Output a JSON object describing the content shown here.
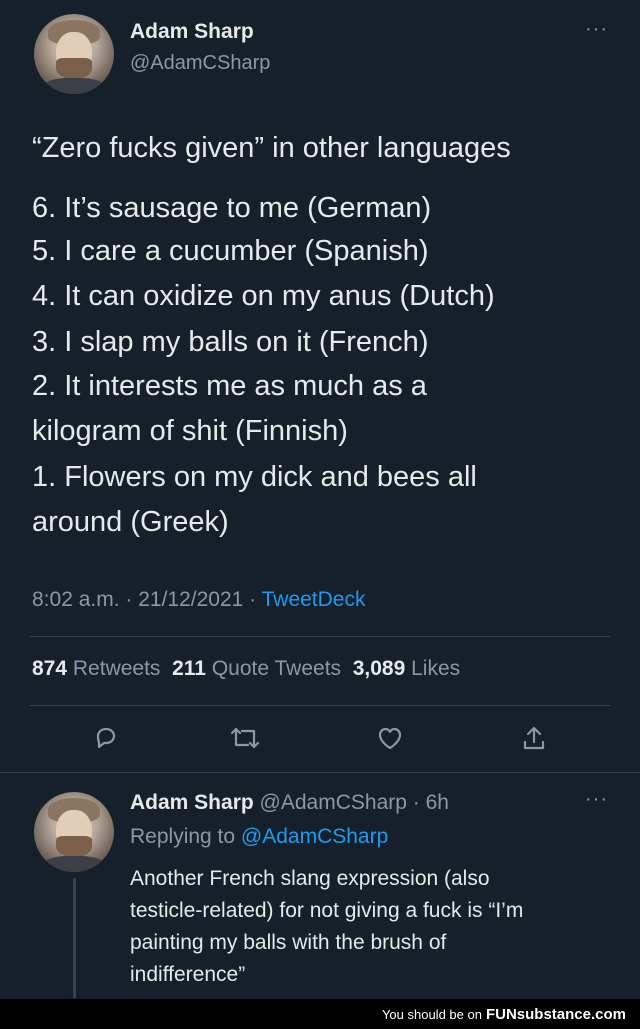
{
  "tweet": {
    "author_name": "Adam Sharp",
    "author_handle": "@AdamCSharp",
    "more_icon": "more-icon",
    "lines": [
      "“Zero fucks given” in other languages",
      "6. It’s sausage to me (German)",
      "5. I care a cucumber (Spanish)",
      "4. It can oxidize on my anus (Dutch)",
      "3. I slap my balls on it (French)",
      "2. It interests me as much as a",
      "kilogram of shit (Finnish)",
      "1. Flowers on my dick and bees all",
      "around (Greek)"
    ],
    "timestamp": "8:02 a.m. · 21/12/2021 · ",
    "source": "TweetDeck",
    "stats": {
      "retweets_count": "874",
      "retweets_label": "Retweets",
      "quotes_count": "211",
      "quotes_label": "Quote Tweets",
      "likes_count": "3,089",
      "likes_label": "Likes"
    },
    "actions": [
      "reply-icon",
      "retweet-icon",
      "like-icon",
      "share-icon"
    ]
  },
  "reply": {
    "author_name": "Adam Sharp",
    "author_meta": "@AdamCSharp · 6h",
    "replying_prefix": "Replying to ",
    "replying_to": "@AdamCSharp",
    "text_lines": [
      "Another French slang expression (also",
      "testicle-related) for not giving a fuck is “I’m",
      "painting my balls with the brush of",
      "indifference”"
    ]
  },
  "footer": {
    "text": "You should be on",
    "brand": "FUNsubstance.com"
  },
  "colors": {
    "background": "#15202b",
    "accent": "#1d9bf0",
    "muted": "#8b98a5",
    "divider": "#38444d"
  }
}
